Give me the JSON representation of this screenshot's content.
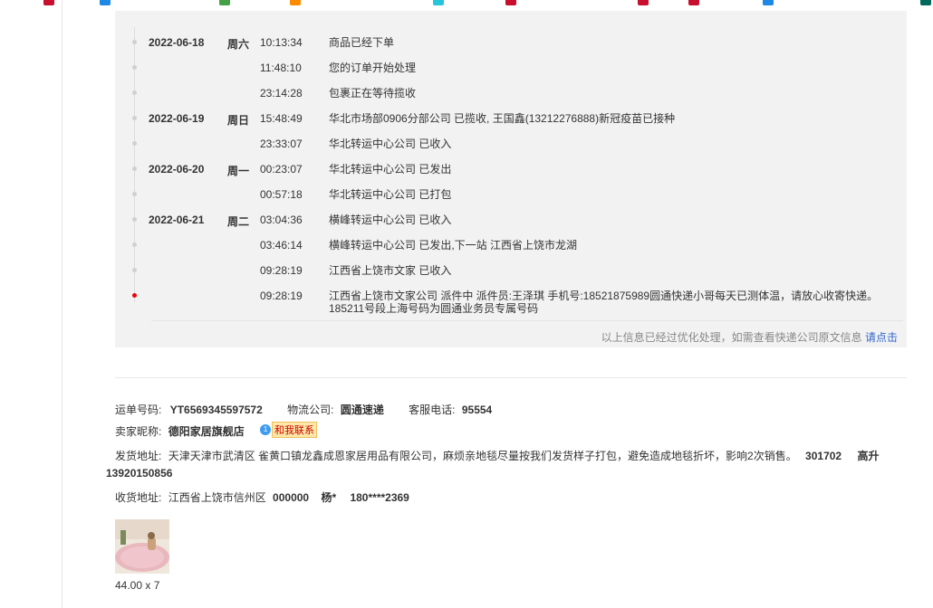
{
  "tracking": {
    "events": [
      {
        "date": "2022-06-18",
        "weekday": "周六",
        "time": "10:13:34",
        "desc": "商品已经下单"
      },
      {
        "date": "",
        "weekday": "",
        "time": "11:48:10",
        "desc": "您的订单开始处理"
      },
      {
        "date": "",
        "weekday": "",
        "time": "23:14:28",
        "desc": "包裹正在等待揽收"
      },
      {
        "date": "2022-06-19",
        "weekday": "周日",
        "time": "15:48:49",
        "desc": "华北市场部0906分部公司 已揽收, 王国鑫(13212276888)新冠疫苗已接种"
      },
      {
        "date": "",
        "weekday": "",
        "time": "23:33:07",
        "desc": "华北转运中心公司 已收入"
      },
      {
        "date": "2022-06-20",
        "weekday": "周一",
        "time": "00:23:07",
        "desc": "华北转运中心公司 已发出"
      },
      {
        "date": "",
        "weekday": "",
        "time": "00:57:18",
        "desc": "华北转运中心公司 已打包"
      },
      {
        "date": "2022-06-21",
        "weekday": "周二",
        "time": "03:04:36",
        "desc": "横峰转运中心公司 已收入"
      },
      {
        "date": "",
        "weekday": "",
        "time": "03:46:14",
        "desc": "横峰转运中心公司 已发出,下一站 江西省上饶市龙湖"
      },
      {
        "date": "",
        "weekday": "",
        "time": "09:28:19",
        "desc": "江西省上饶市文家 已收入"
      },
      {
        "date": "",
        "weekday": "",
        "time": "09:28:19",
        "desc": "江西省上饶市文家公司 派件中 派件员:王泽琪 手机号:18521875989圆通快递小哥每天已测体温，请放心收寄快递。185211号段上海号码为圆通业务员专属号码"
      }
    ],
    "note_text": "以上信息已经过优化处理，如需查看快递公司原文信息",
    "note_link": "请点击"
  },
  "shipment": {
    "waybill_label": "运单号码:",
    "waybill_no": "YT6569345597572",
    "carrier_label": "物流公司:",
    "carrier": "圆通速递",
    "service_label": "客服电话:",
    "service_phone": "95554",
    "seller_label": "卖家昵称:",
    "seller": "德阳家居旗舰店",
    "contact_label": "和我联系",
    "ship_from_label": "发货地址:",
    "ship_from": "天津天津市武清区 雀黄口镇龙鑫成恩家居用品有限公司，麻烦亲地毯尽量按我们发货样子打包，避免造成地毯折坏，影响2次销售。",
    "ship_from_zip": "301702",
    "ship_from_name": "高升",
    "ship_from_phone": "13920150856",
    "ship_to_label": "收货地址:",
    "ship_to": "江西省上饶市信州区",
    "ship_to_zip": "000000",
    "ship_to_name": "杨*",
    "ship_to_phone": "180****2369"
  },
  "product": {
    "price_qty": "44.00 x 7"
  }
}
